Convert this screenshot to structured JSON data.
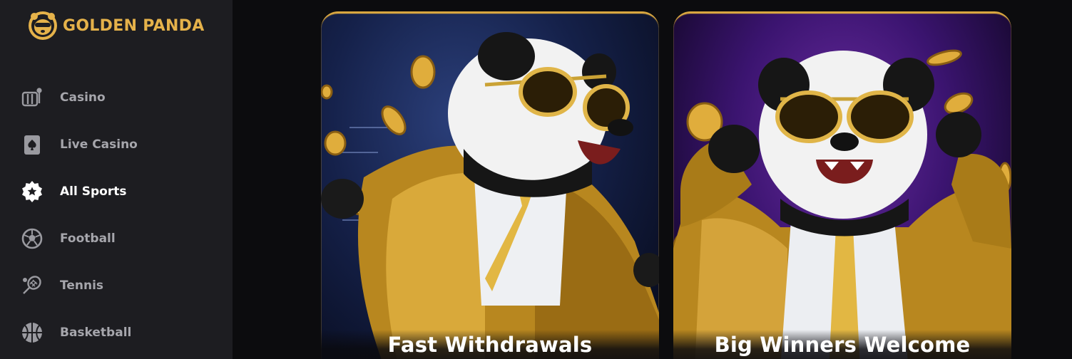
{
  "brand": {
    "name": "GOLDEN PANDA",
    "accent": "#e5b24a"
  },
  "sidebar": {
    "items": [
      {
        "label": "Casino",
        "icon": "slot-machine-icon",
        "active": false
      },
      {
        "label": "Live Casino",
        "icon": "spade-card-icon",
        "active": false
      },
      {
        "label": "All Sports",
        "icon": "star-badge-icon",
        "active": true
      },
      {
        "label": "Football",
        "icon": "football-icon",
        "active": false
      },
      {
        "label": "Tennis",
        "icon": "tennis-racket-icon",
        "active": false
      },
      {
        "label": "Basketball",
        "icon": "basketball-icon",
        "active": false
      }
    ]
  },
  "promos": [
    {
      "title": "Fast Withdrawals",
      "image": "panda-gold-jacket-coins-blue"
    },
    {
      "title": "Big Winners Welcome",
      "image": "panda-gold-jacket-coins-purple"
    }
  ],
  "colors": {
    "sidebar_bg": "#1d1d21",
    "page_bg": "#0c0c0e",
    "gold": "#d8a640",
    "muted_text": "#a6a6ac"
  }
}
